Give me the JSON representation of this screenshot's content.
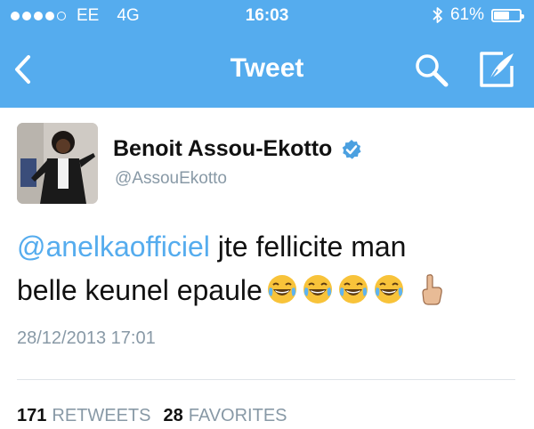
{
  "status_bar": {
    "carrier": "EE",
    "network": "4G",
    "time": "16:03",
    "battery": "61%",
    "battery_level": 0.61,
    "signal_bars_filled": 4,
    "signal_bars_total": 5
  },
  "nav": {
    "title": "Tweet",
    "back_icon": "chevron-left-icon",
    "search_icon": "search-icon",
    "compose_icon": "compose-icon"
  },
  "tweet": {
    "author_name": "Benoit Assou-Ekotto",
    "handle": "@AssouEkotto",
    "verified": true,
    "mention": "@anelkaofficiel",
    "text_line1": " jte fellicite man",
    "text_line2": "belle keunel epaule",
    "emojis": [
      "face-with-tears-of-joy",
      "face-with-tears-of-joy",
      "face-with-tears-of-joy",
      "face-with-tears-of-joy",
      "pointing-up-hand"
    ],
    "timestamp": "28/12/2013 17:01"
  },
  "stats": {
    "retweets_count": "171",
    "retweets_label": "RETWEETS",
    "favorites_count": "28",
    "favorites_label": "FAVORITES"
  },
  "colors": {
    "brand": "#55acee",
    "meta_text": "#8899a6",
    "verified_badge": "#4ba0e0"
  }
}
